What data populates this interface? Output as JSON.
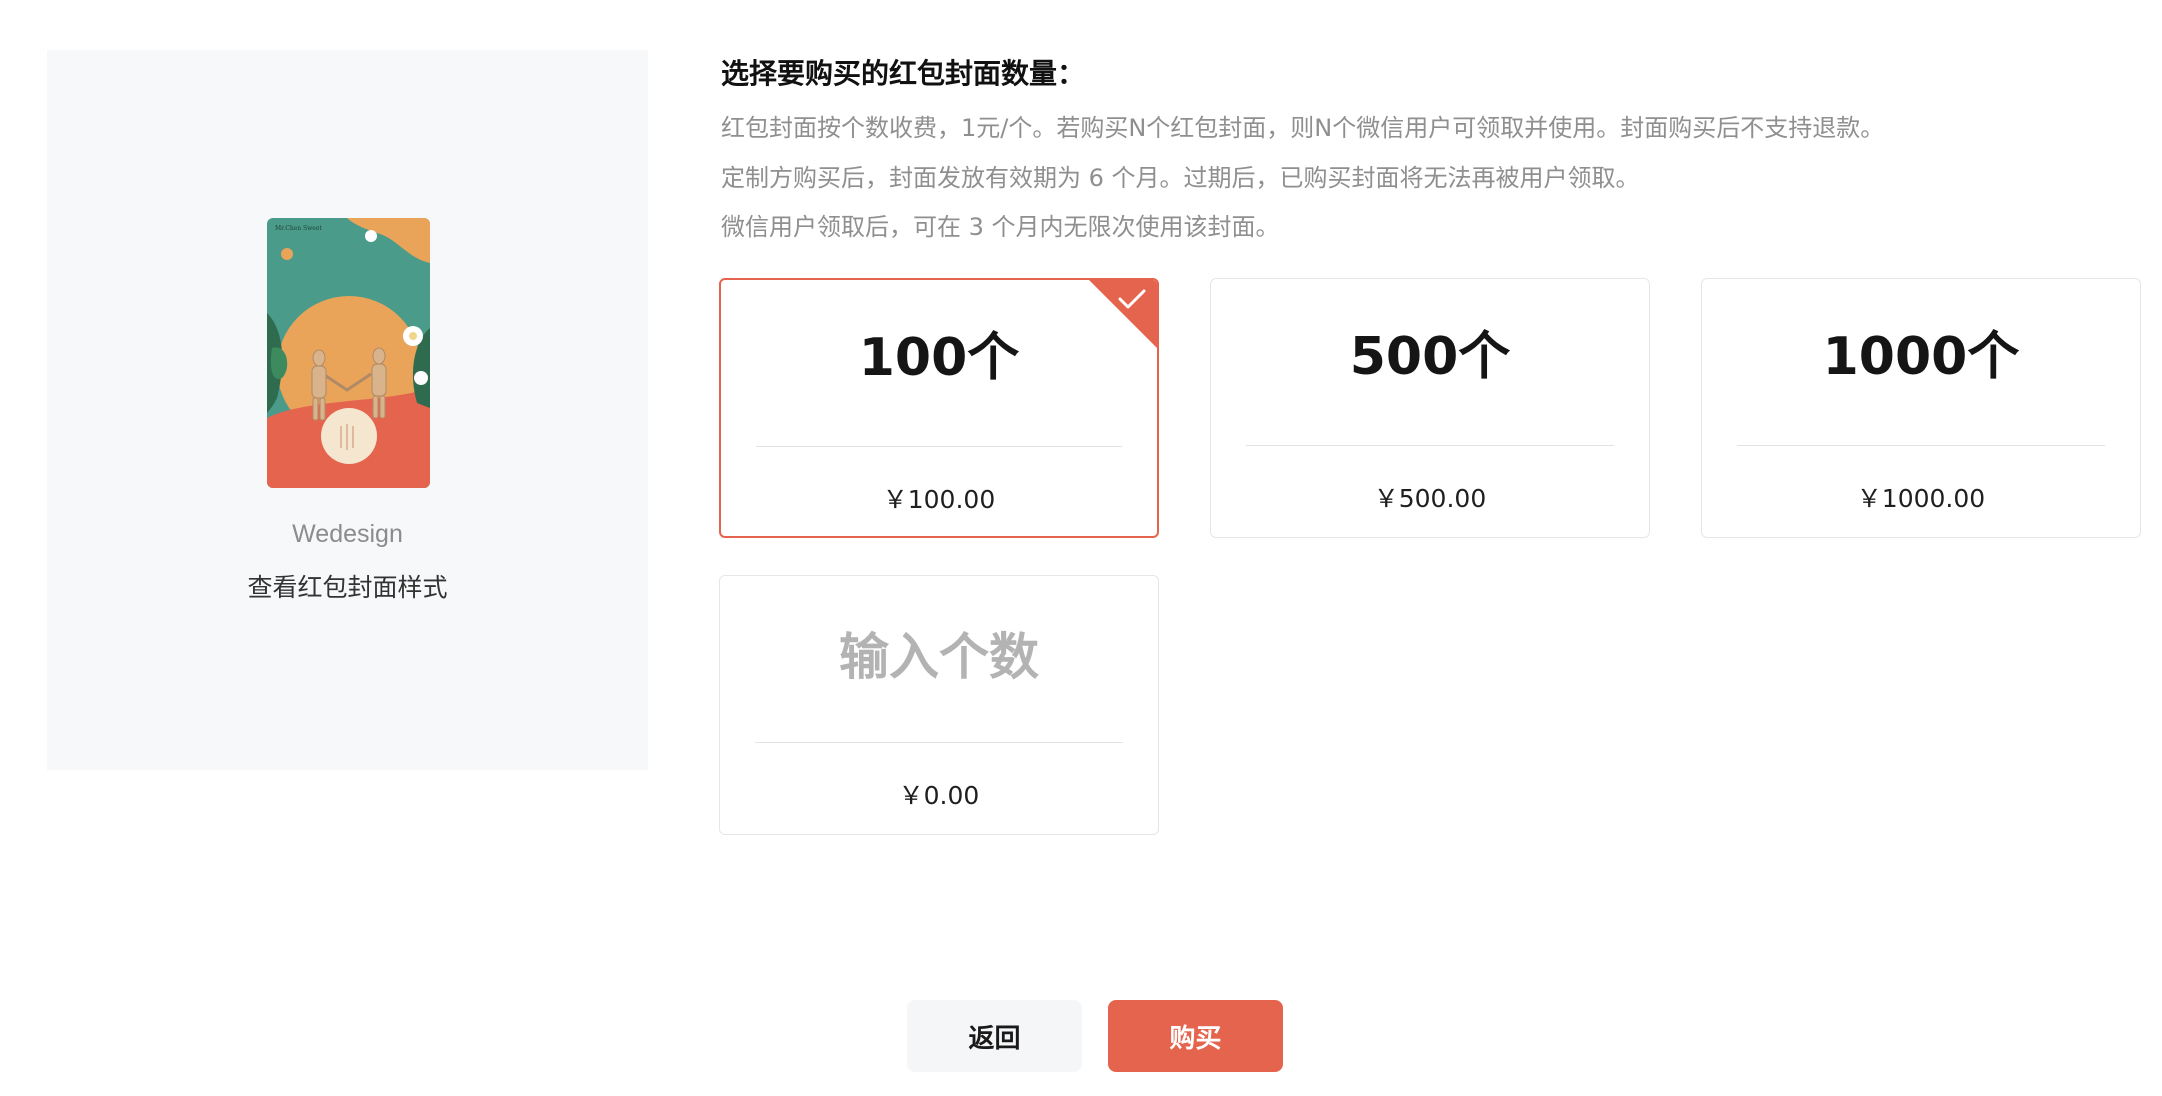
{
  "preview": {
    "brand_name": "Wedesign",
    "view_style_label": "查看红包封面样式",
    "cover_small_text": "Mr.Chen Sweet",
    "colors": {
      "teal": "#4a9b8a",
      "orange": "#e9a45a",
      "red": "#e5644e",
      "cream": "#f5e6cf"
    }
  },
  "content": {
    "title": "选择要购买的红包封面数量：",
    "descriptions": [
      "红包封面按个数收费，1元/个。若购买N个红包封面，则N个微信用户可领取并使用。封面购买后不支持退款。",
      "定制方购买后，封面发放有效期为 6 个月。过期后，已购买封面将无法再被用户领取。",
      "微信用户领取后，可在 3 个月内无限次使用该封面。"
    ]
  },
  "options": [
    {
      "quantity_label": "100个",
      "price": "￥100.00",
      "selected": true
    },
    {
      "quantity_label": "500个",
      "price": "￥500.00",
      "selected": false
    },
    {
      "quantity_label": "1000个",
      "price": "￥1000.00",
      "selected": false
    },
    {
      "quantity_placeholder": "输入个数",
      "price": "￥0.00",
      "selected": false
    }
  ],
  "actions": {
    "back_label": "返回",
    "buy_label": "购买"
  },
  "theme": {
    "accent": "#e5644e",
    "card_border": "#e6e6e6",
    "panel_bg": "#f7f8fa"
  }
}
